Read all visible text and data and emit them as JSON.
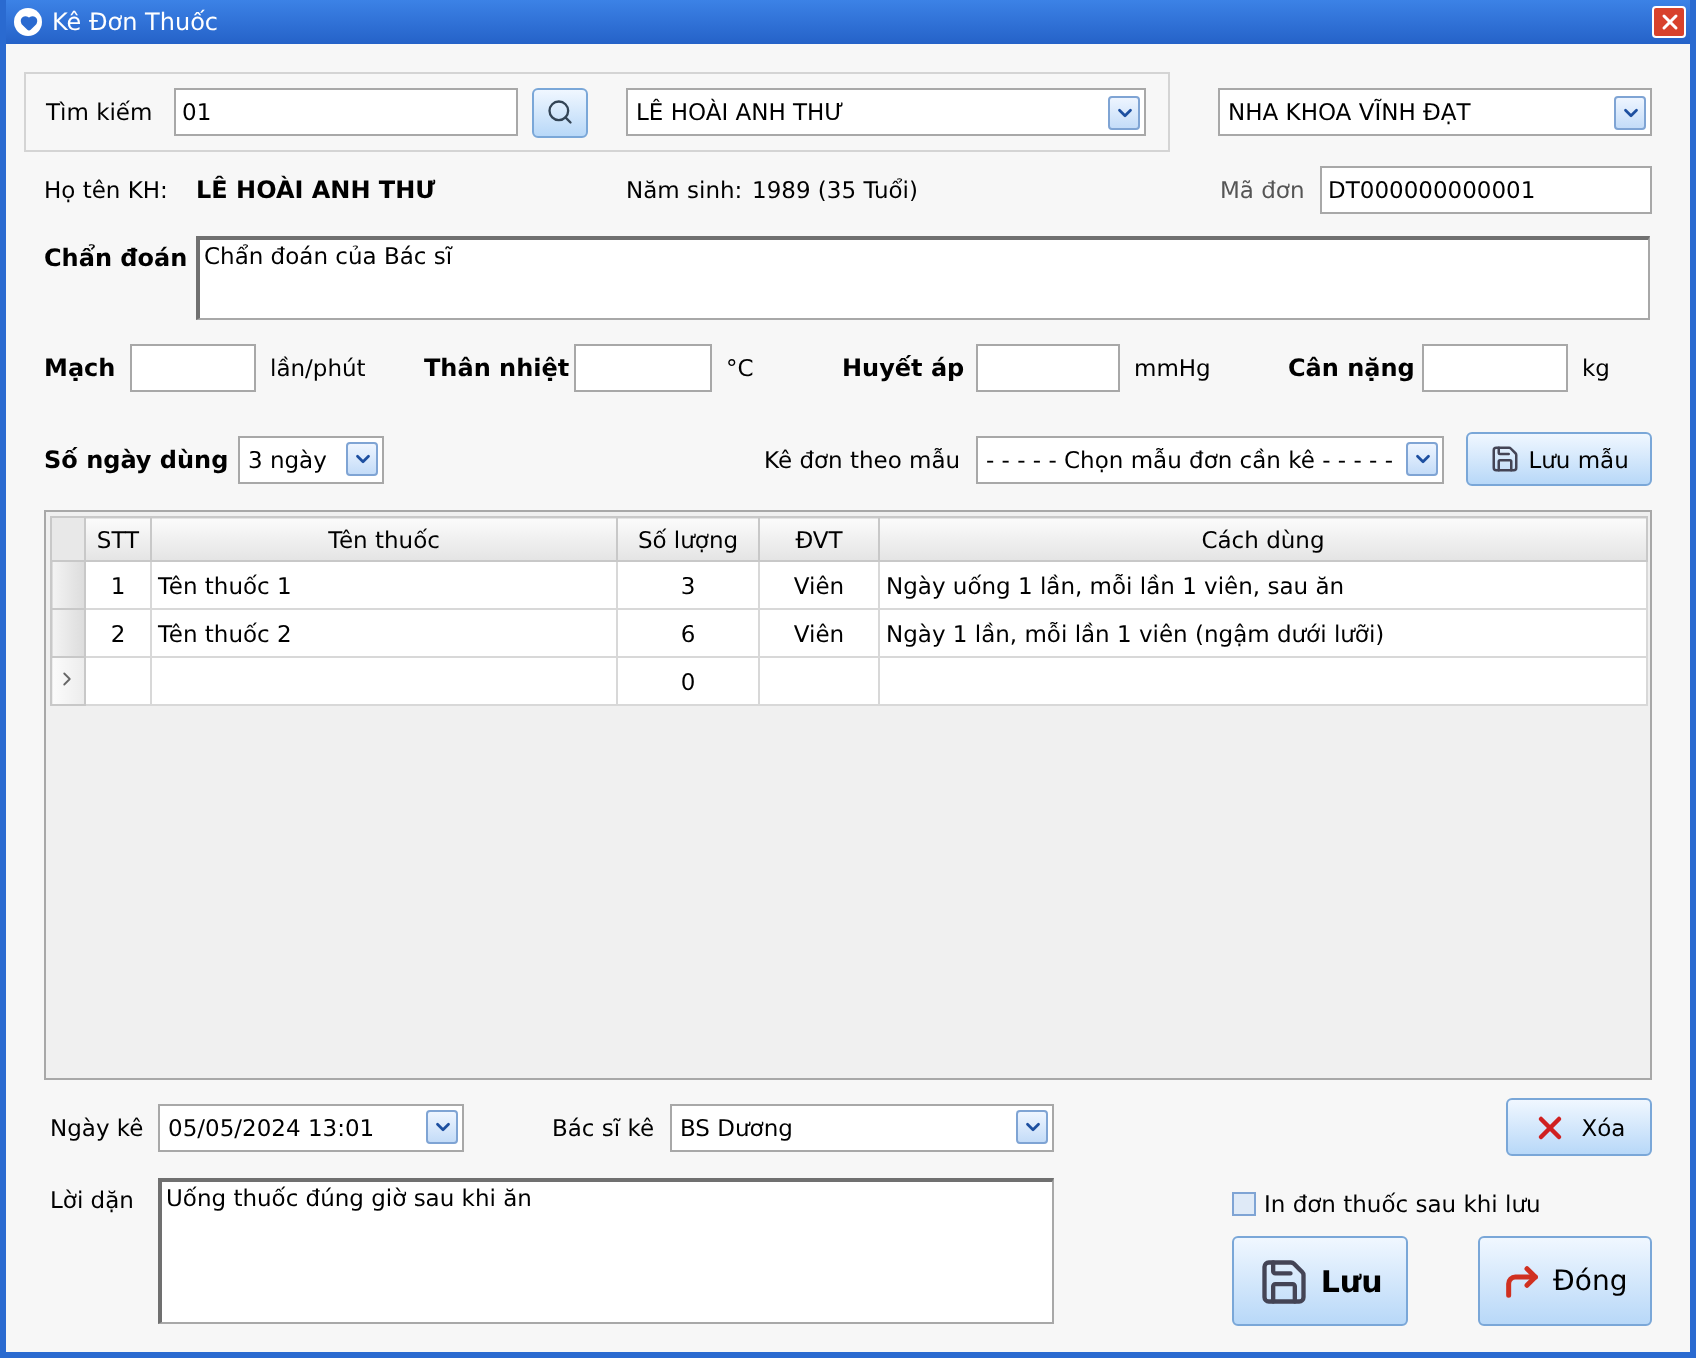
{
  "window": {
    "title": "Kê Đơn Thuốc"
  },
  "search": {
    "label": "Tìm kiếm",
    "value": "01",
    "patient_combo": "LÊ HOÀI ANH THƯ"
  },
  "clinic_combo": "NHA KHOA VĨNH ĐẠT",
  "patient": {
    "name_label": "Họ tên KH:",
    "name": "LÊ HOÀI ANH THƯ",
    "birth_label": "Năm sinh:",
    "birth": "1989 (35 Tuổi)",
    "code_label": "Mã đơn",
    "code": "DT000000000001"
  },
  "diagnosis": {
    "label": "Chẩn đoán",
    "value": "Chẩn đoán của Bác sĩ"
  },
  "vitals": [
    {
      "label": "Mạch",
      "unit": "lần/phút"
    },
    {
      "label": "Thân nhiệt",
      "unit": "°C"
    },
    {
      "label": "Huyết áp",
      "unit": "mmHg"
    },
    {
      "label": "Cân nặng",
      "unit": "kg"
    }
  ],
  "days": {
    "label": "Số ngày dùng",
    "value": "3 ngày"
  },
  "template": {
    "label": "Kê đơn theo mẫu",
    "value": "- - - - - Chọn mẫu đơn cần kê - - - - -",
    "save_button": "Lưu mẫu"
  },
  "table": {
    "columns": [
      "STT",
      "Tên thuốc",
      "Số lượng",
      "ĐVT",
      "Cách dùng"
    ],
    "rows": [
      {
        "cells": [
          "1",
          "Tên thuốc 1",
          "3",
          "Viên",
          "Ngày uống 1 lần, mỗi lần 1 viên, sau ăn"
        ],
        "selected": false
      },
      {
        "cells": [
          "2",
          "Tên thuốc 2",
          "6",
          "Viên",
          "Ngày 1 lần, mỗi lần 1 viên (ngậm dưới lưỡi)"
        ],
        "selected": false
      },
      {
        "cells": [
          "",
          "",
          "0",
          "",
          ""
        ],
        "selected": true
      }
    ]
  },
  "date": {
    "label": "Ngày kê",
    "value": "05/05/2024 13:01"
  },
  "doctor": {
    "label": "Bác sĩ kê",
    "value": "BS Dương"
  },
  "delete_button": "Xóa",
  "advice": {
    "label": "Lời dặn",
    "value": "Uống thuốc đúng giờ sau khi ăn"
  },
  "print_after_save": {
    "label": "In đơn thuốc sau khi lưu",
    "checked": false
  },
  "buttons": {
    "save": "Lưu",
    "close": "Đóng"
  }
}
